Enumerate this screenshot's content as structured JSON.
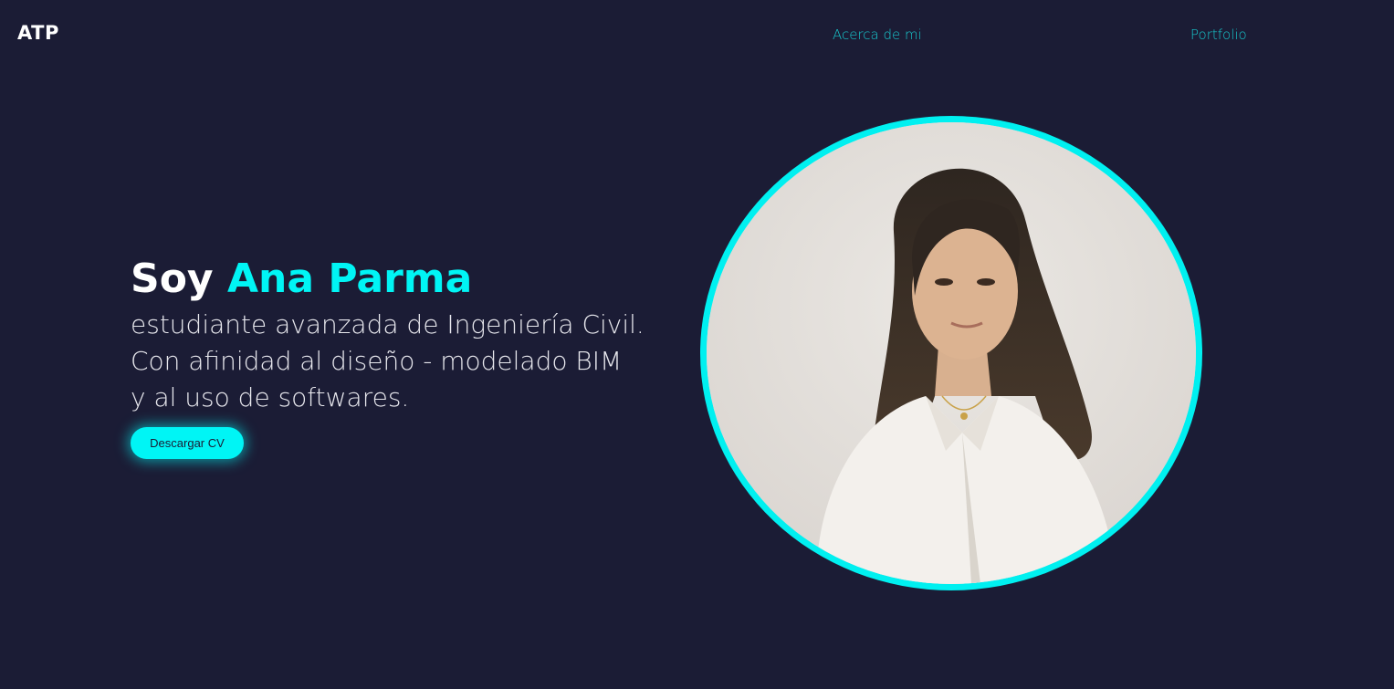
{
  "header": {
    "logo": "ATP",
    "nav": {
      "about": "Acerca de mi",
      "portfolio": "Portfolio"
    }
  },
  "hero": {
    "greeting": "Soy",
    "name": "Ana Parma",
    "tagline_lines": [
      "estudiante avanzada de Ingeniería Civil.",
      "Con afinidad al diseño - modelado BIM",
      "y al uso de softwares."
    ],
    "cv_button": "Descargar CV"
  },
  "colors": {
    "background": "#1b1c35",
    "accent": "#00f5f5",
    "nav_link": "#18c7cc",
    "text": "#ffffff"
  }
}
